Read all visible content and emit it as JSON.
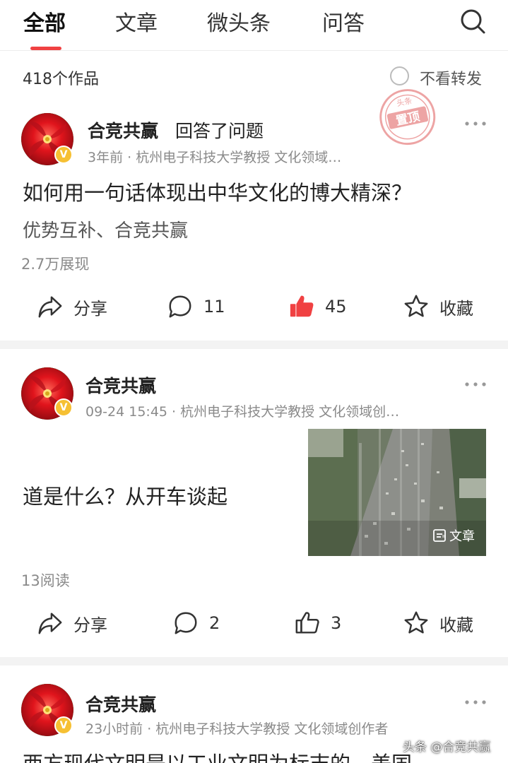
{
  "tabs": [
    {
      "label": "全部",
      "active": true
    },
    {
      "label": "文章",
      "active": false
    },
    {
      "label": "微头条",
      "active": false
    },
    {
      "label": "问答",
      "active": false
    }
  ],
  "colors": {
    "accent": "#f04142",
    "like_active": "#f04142",
    "verify_badge": "#f6c033"
  },
  "filter": {
    "works_count": "418个作品",
    "hide_forward_label": "不看转发"
  },
  "pinned_stamp": {
    "top_text": "头条",
    "label": "置顶"
  },
  "posts": [
    {
      "author": "合竞共赢",
      "action": "回答了问题",
      "meta": "3年前 · 杭州电子科技大学教授 文化领域…",
      "title": "如何用一句话体现出中华文化的博大精深？",
      "answer": "优势互补、合竞共赢",
      "stat": "2.7万展现",
      "share_label": "分享",
      "comments": "11",
      "likes": "45",
      "liked": true,
      "favorite_label": "收藏"
    },
    {
      "author": "合竞共赢",
      "meta": "09-24 15:45 · 杭州电子科技大学教授 文化领域创…",
      "title": "道是什么？从开车谈起",
      "thumb_tag": "文章",
      "stat": "13阅读",
      "share_label": "分享",
      "comments": "2",
      "likes": "3",
      "liked": false,
      "favorite_label": "收藏"
    },
    {
      "author": "合竞共赢",
      "meta": "23小时前 · 杭州电子科技大学教授 文化领域创作者",
      "title": "西方现代文明是以工业文明为标志的，美国"
    }
  ],
  "watermark": "头条 @合竞共赢",
  "icons": [
    "search-icon",
    "more-icon",
    "share-icon",
    "comment-icon",
    "like-icon",
    "star-icon",
    "article-icon",
    "verified-icon"
  ]
}
